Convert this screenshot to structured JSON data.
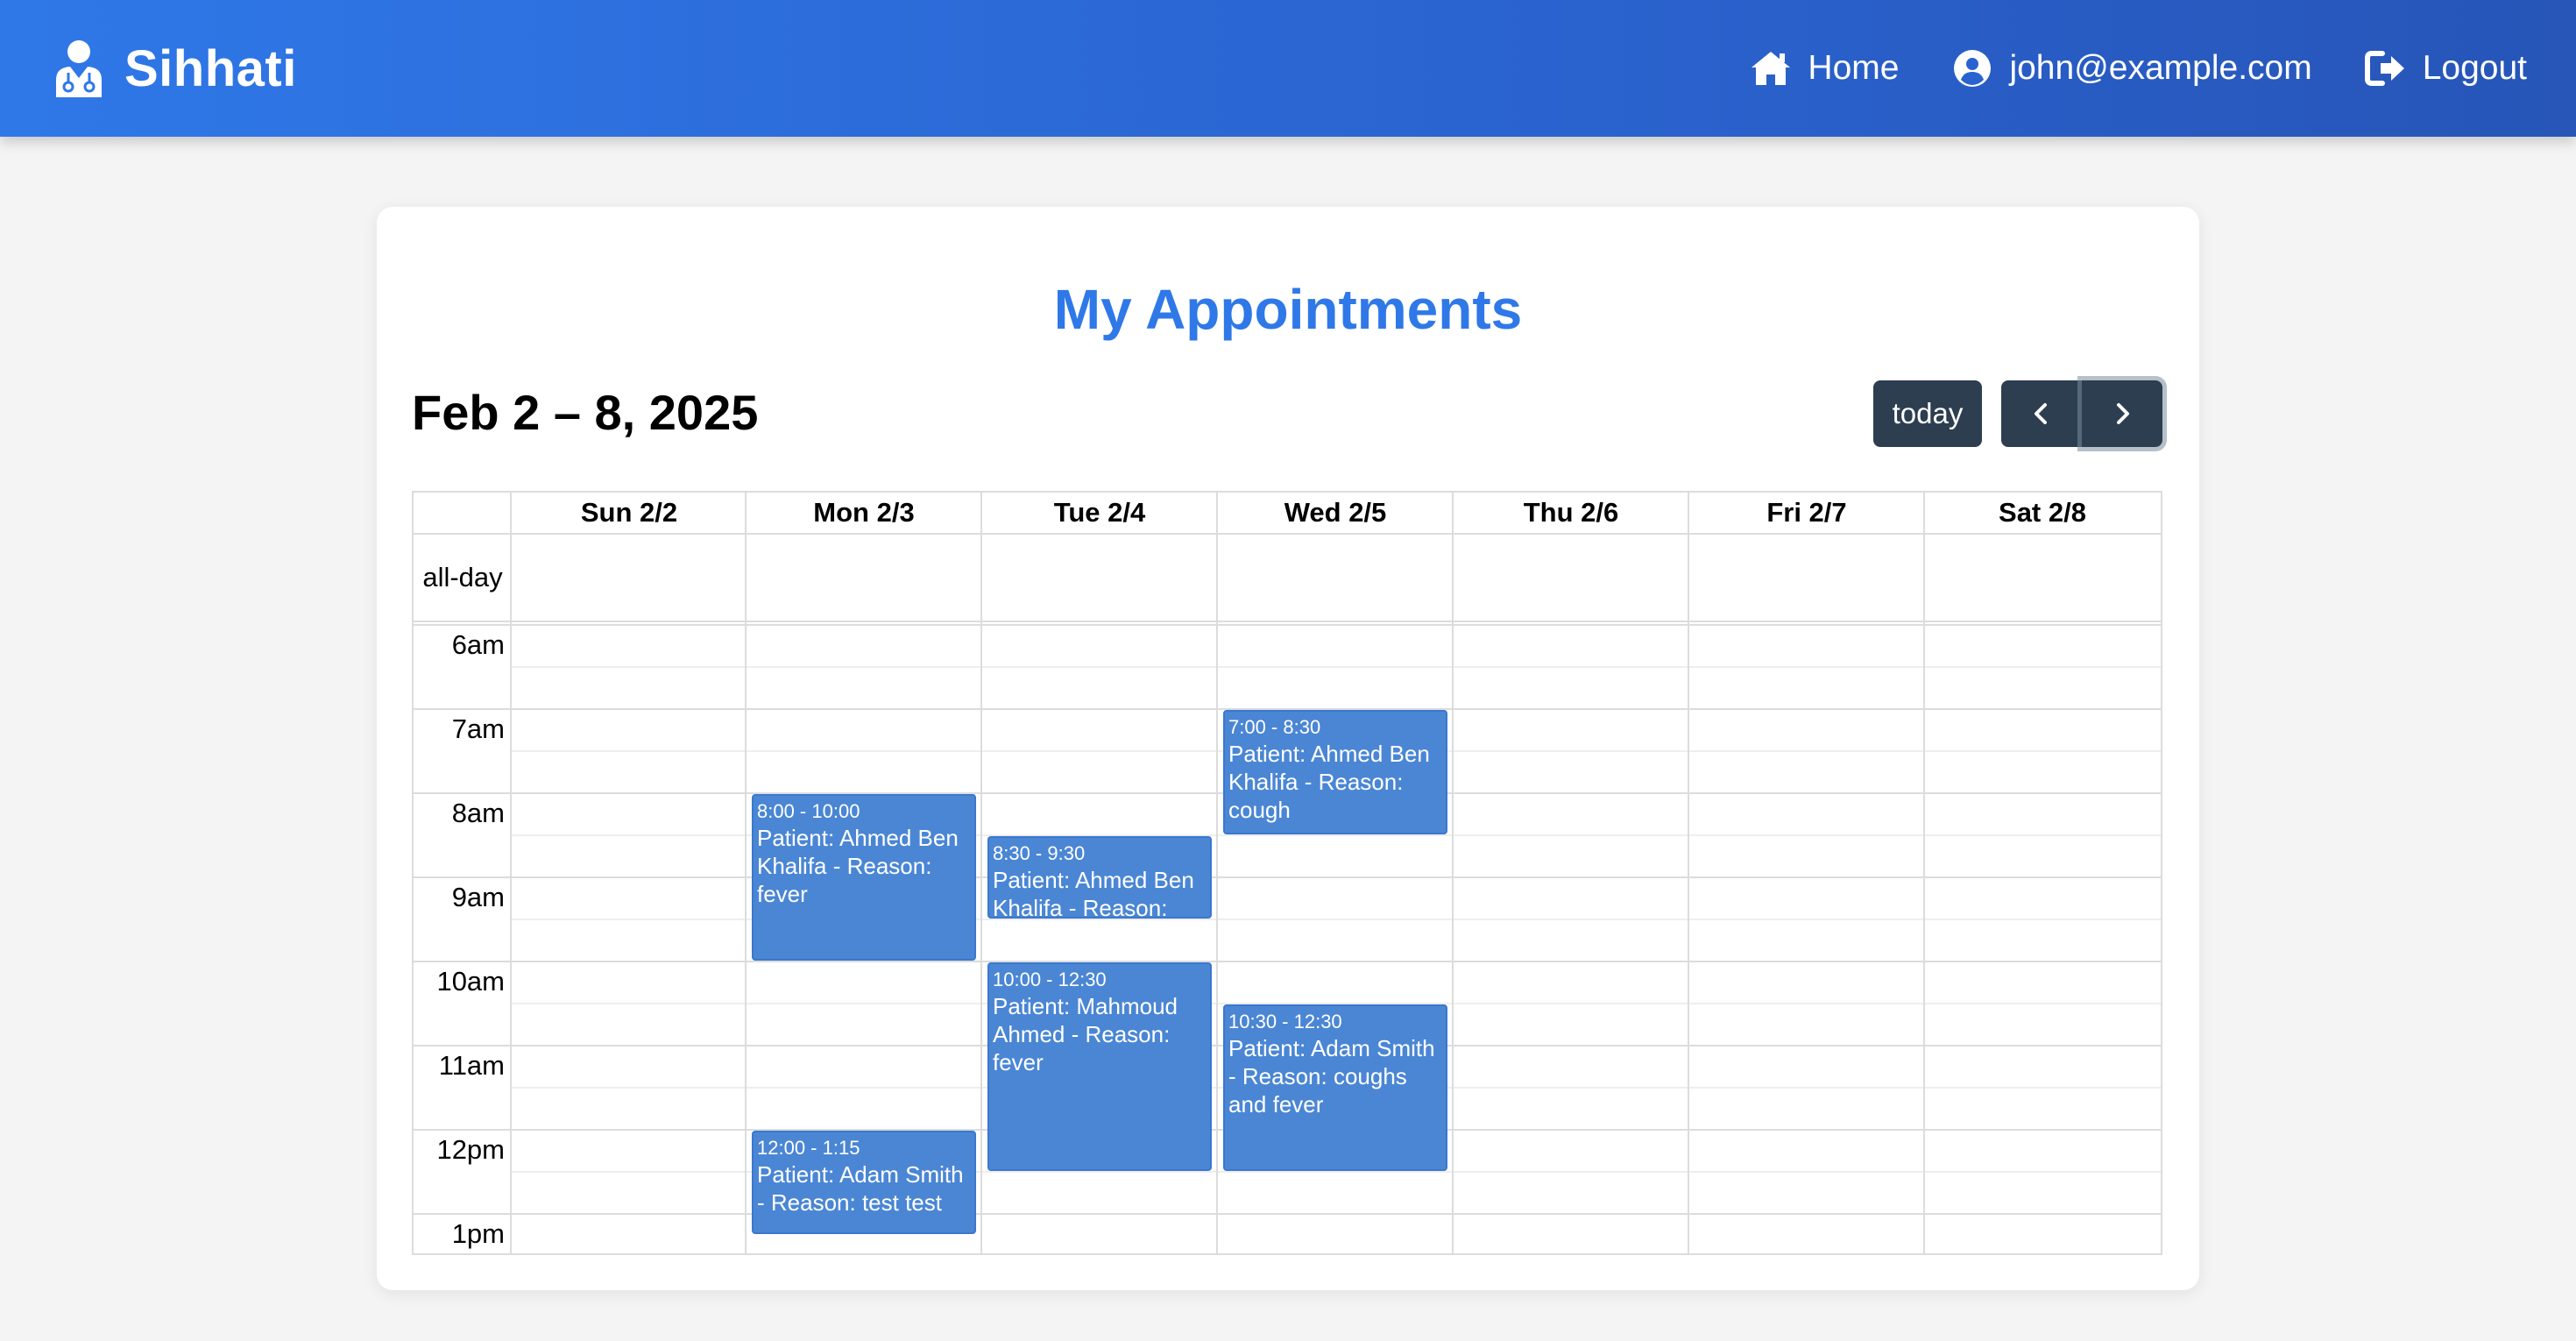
{
  "brand": {
    "name": "Sihhati"
  },
  "nav": {
    "home": "Home",
    "user": "john@example.com",
    "logout": "Logout"
  },
  "page": {
    "title": "My Appointments"
  },
  "calendar": {
    "range_title": "Feb 2 – 8, 2025",
    "today_label": "today",
    "allday_label": "all-day",
    "days": [
      "Sun 2/2",
      "Mon 2/3",
      "Tue 2/4",
      "Wed 2/5",
      "Thu 2/6",
      "Fri 2/7",
      "Sat 2/8"
    ],
    "times": [
      "6am",
      "7am",
      "8am",
      "9am",
      "10am",
      "11am",
      "12pm",
      "1pm"
    ],
    "events": [
      {
        "day": 1,
        "time": "8:00 - 10:00",
        "title": "Patient: Ahmed Ben Khalifa - Reason: fever"
      },
      {
        "day": 1,
        "time": "12:00 - 1:15",
        "title": "Patient: Adam Smith - Reason: test test"
      },
      {
        "day": 2,
        "time": "8:30 - 9:30",
        "title": "Patient: Ahmed Ben Khalifa - Reason:"
      },
      {
        "day": 2,
        "time": "10:00 - 12:30",
        "title": "Patient: Mahmoud Ahmed - Reason: fever"
      },
      {
        "day": 3,
        "time": "7:00 - 8:30",
        "title": "Patient: Ahmed Ben Khalifa - Reason: cough"
      },
      {
        "day": 3,
        "time": "10:30 - 12:30",
        "title": "Patient: Adam Smith - Reason: coughs and fever"
      }
    ]
  },
  "colors": {
    "brand_blue": "#2f78e8",
    "event_blue": "#4a86d4",
    "button_dark": "#2c3e50"
  }
}
